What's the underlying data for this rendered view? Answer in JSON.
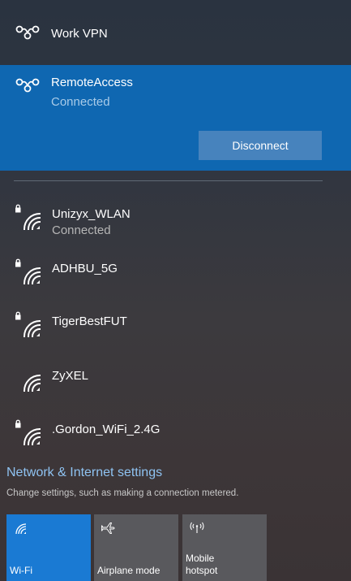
{
  "vpn": [
    {
      "name": "Work VPN",
      "status": ""
    },
    {
      "name": "RemoteAccess",
      "status": "Connected",
      "button": "Disconnect"
    }
  ],
  "wifi": [
    {
      "name": "Unizyx_WLAN",
      "status": "Connected",
      "secured": true
    },
    {
      "name": "ADHBU_5G",
      "status": "",
      "secured": true
    },
    {
      "name": "TigerBestFUT",
      "status": "",
      "secured": true
    },
    {
      "name": "ZyXEL",
      "status": "",
      "secured": false
    },
    {
      "name": ".Gordon_WiFi_2.4G",
      "status": "",
      "secured": true
    }
  ],
  "settings": {
    "link": "Network & Internet settings",
    "description": "Change settings, such as making a connection metered."
  },
  "quick_actions": [
    {
      "label": "Wi-Fi",
      "icon": "wifi-icon",
      "active": true
    },
    {
      "label": "Airplane mode",
      "icon": "airplane-icon",
      "active": false
    },
    {
      "label": "Mobile\nhotspot",
      "icon": "hotspot-icon",
      "active": false
    }
  ],
  "colors": {
    "selected_row": "#0f67b1",
    "button": "#4783bd",
    "link": "#8fc3f2",
    "tile_active": "#1a7ad3",
    "tile_inactive": "#59595d"
  }
}
